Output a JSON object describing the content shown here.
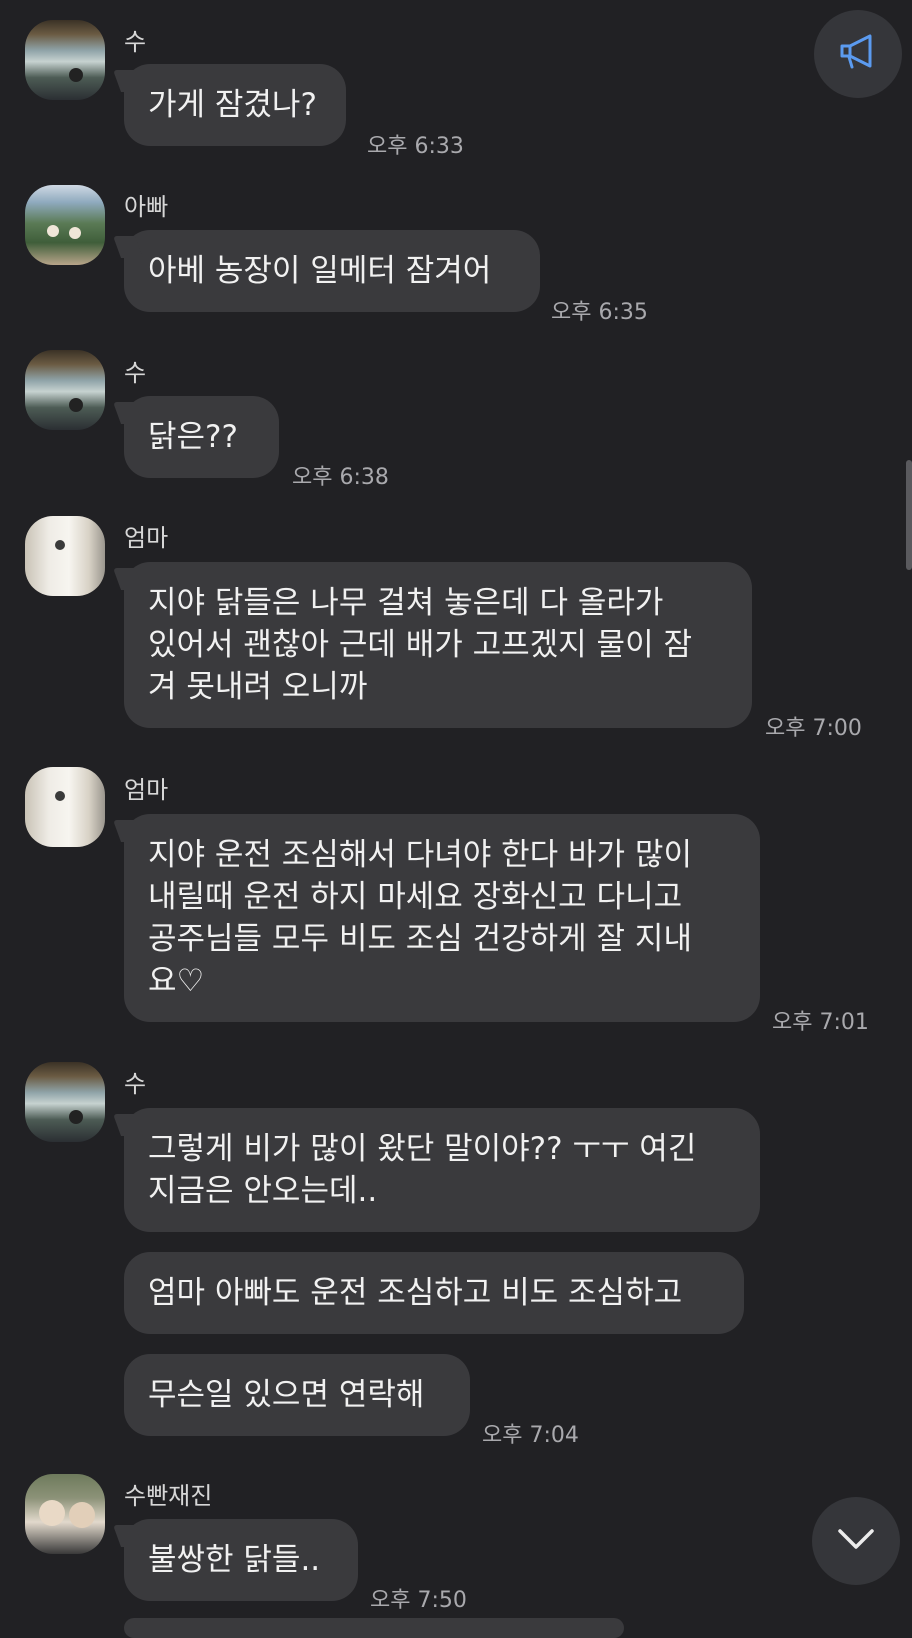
{
  "messages": [
    {
      "sender": "수",
      "bubbles": [
        "가게 잠겼나?"
      ],
      "time": "오후 6:33"
    },
    {
      "sender": "아빠",
      "bubbles": [
        "아베 농장이 일메터 잠겨어"
      ],
      "time": "오후 6:35"
    },
    {
      "sender": "수",
      "bubbles": [
        "닭은??"
      ],
      "time": "오후 6:38"
    },
    {
      "sender": "엄마",
      "bubbles": [
        "지야 닭들은 나무 걸쳐 놓은데 다 올라가\n있어서 괜찮아 근데 배가 고프겠지 물이 잠\n겨 못내려 오니까"
      ],
      "time": "오후 7:00"
    },
    {
      "sender": "엄마",
      "bubbles": [
        "지야 운전 조심해서 다녀야 한다 바가 많이\n내릴때 운전 하지 마세요 장화신고 다니고\n공주님들 모두 비도 조심 건강하게 잘 지내\n요♡"
      ],
      "time": "오후 7:01"
    },
    {
      "sender": "수",
      "bubbles": [
        "그렇게 비가 많이 왔단 말이야?? ㅜㅜ 여긴\n지금은 안오는데..",
        "엄마 아빠도 운전 조심하고 비도 조심하고",
        "무슨일 있으면 연락해"
      ],
      "time": "오후 7:04"
    },
    {
      "sender": "수빤재진",
      "bubbles": [
        "불쌍한 닭들.."
      ],
      "time": "오후 7:50"
    }
  ],
  "icons": {
    "announce": "megaphone-icon",
    "scroll_down": "chevron-down-icon"
  },
  "colors": {
    "background": "#212124",
    "bubble": "#3a3a3d",
    "accent_icon": "#5b9bf0"
  }
}
